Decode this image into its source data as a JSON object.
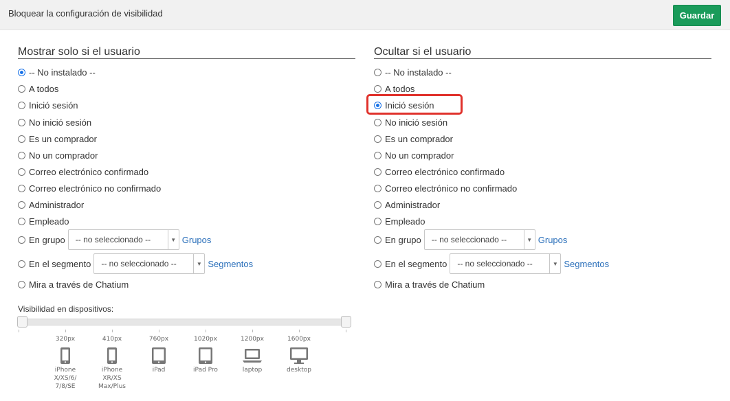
{
  "header": {
    "title": "Bloquear la configuración de visibilidad",
    "save_label": "Guardar"
  },
  "show_section": {
    "title": "Mostrar solo si el usuario",
    "selected": "-- No instalado --",
    "options": [
      "-- No instalado --",
      "A todos",
      "Inició sesión",
      "No inició sesión",
      "Es un comprador",
      "No un comprador",
      "Correo electrónico confirmado",
      "Correo electrónico no confirmado",
      "Administrador",
      "Empleado"
    ],
    "group": {
      "label": "En grupo",
      "select_value": "-- no seleccionado --",
      "link": "Grupos"
    },
    "segment": {
      "label": "En el segmento",
      "select_value": "-- no seleccionado --",
      "link": "Segmentos"
    },
    "chatium": "Mira a través de Chatium"
  },
  "hide_section": {
    "title": "Ocultar si el usuario",
    "selected": "Inició sesión",
    "options": [
      "-- No instalado --",
      "A todos",
      "Inició sesión",
      "No inició sesión",
      "Es un comprador",
      "No un comprador",
      "Correo electrónico confirmado",
      "Correo electrónico no confirmado",
      "Administrador",
      "Empleado"
    ],
    "group": {
      "label": "En grupo",
      "select_value": "-- no seleccionado --",
      "link": "Grupos"
    },
    "segment": {
      "label": "En el segmento",
      "select_value": "-- no seleccionado --",
      "link": "Segmentos"
    },
    "chatium": "Mira a través de Chatium"
  },
  "devices": {
    "label": "Visibilidad en dispositivos:",
    "range": [
      0,
      1
    ],
    "items": [
      {
        "px": "320px",
        "name": "iPhone\nX/XS/6/\n7/8/SE",
        "icon": "phone-icon"
      },
      {
        "px": "410px",
        "name": "iPhone\nXR/XS\nMax/Plus",
        "icon": "phone-icon"
      },
      {
        "px": "760px",
        "name": "iPad",
        "icon": "tablet-icon"
      },
      {
        "px": "1020px",
        "name": "iPad Pro",
        "icon": "tablet-icon"
      },
      {
        "px": "1200px",
        "name": "laptop",
        "icon": "laptop-icon"
      },
      {
        "px": "1600px",
        "name": "desktop",
        "icon": "desktop-icon"
      }
    ]
  },
  "colors": {
    "accent": "#1a9b5a",
    "radio": "#1a73e8",
    "link": "#2a6fba",
    "highlight": "#e0312b"
  }
}
